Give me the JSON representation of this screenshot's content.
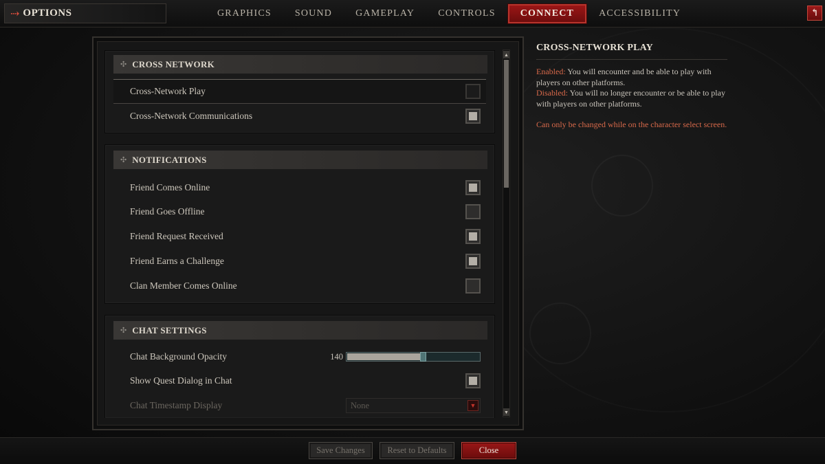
{
  "header": {
    "options_label": "OPTIONS",
    "tabs": [
      {
        "label": "GRAPHICS",
        "active": false
      },
      {
        "label": "SOUND",
        "active": false
      },
      {
        "label": "GAMEPLAY",
        "active": false
      },
      {
        "label": "CONTROLS",
        "active": false
      },
      {
        "label": "CONNECT",
        "active": true
      },
      {
        "label": "ACCESSIBILITY",
        "active": false
      }
    ],
    "back_icon": "return-arrow-icon"
  },
  "sections": {
    "cross_network": {
      "title": "CROSS NETWORK",
      "items": [
        {
          "label": "Cross-Network Play",
          "checked": false
        },
        {
          "label": "Cross-Network Communications",
          "checked": true
        }
      ]
    },
    "notifications": {
      "title": "NOTIFICATIONS",
      "items": [
        {
          "label": "Friend Comes Online",
          "checked": true
        },
        {
          "label": "Friend Goes Offline",
          "checked": false
        },
        {
          "label": "Friend Request Received",
          "checked": true
        },
        {
          "label": "Friend Earns a Challenge",
          "checked": true
        },
        {
          "label": "Clan Member Comes Online",
          "checked": false
        }
      ]
    },
    "chat": {
      "title": "CHAT SETTINGS",
      "opacity_label": "Chat Background Opacity",
      "opacity_value": "140",
      "opacity_fraction": 0.55,
      "quest_label": "Show Quest Dialog in Chat",
      "quest_checked": true,
      "timestamp_label": "Chat Timestamp Display",
      "timestamp_value": "None"
    }
  },
  "info": {
    "title": "CROSS-NETWORK PLAY",
    "enabled_label": "Enabled:",
    "enabled_text": "You will encounter and be able to play with players on other platforms.",
    "disabled_label": "Disabled:",
    "disabled_text": "You will no longer encounter or be able to play with players on other platforms.",
    "warning": "Can only be changed while on the character select screen."
  },
  "footer": {
    "save_label": "Save Changes",
    "reset_label": "Reset to Defaults",
    "close_label": "Close"
  },
  "colors": {
    "accent_red": "#9b1616",
    "info_label": "#d8694a",
    "slider_thumb": "#4f7475"
  }
}
